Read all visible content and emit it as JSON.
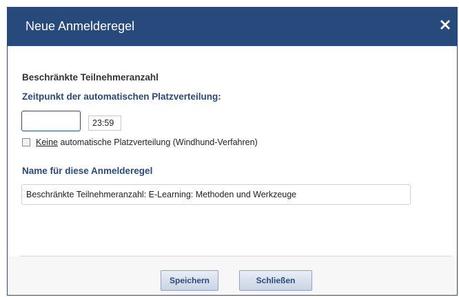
{
  "dialog": {
    "title": "Neue Anmelderegel",
    "close_icon": "close-icon"
  },
  "rule": {
    "type_label": "Beschränkte Teilnehmeranzahl",
    "distribution_heading": "Zeitpunkt der automatischen Platzverteilung:",
    "date_value": "",
    "time_value": "23:59",
    "no_auto_checkbox_underlined": "Keine",
    "no_auto_checkbox_rest": " automatische Platzverteilung (Windhund-Verfahren)",
    "no_auto_checked": false,
    "name_heading": "Name für diese Anmelderegel",
    "name_value": "Beschränkte Teilnehmeranzahl: E-Learning: Methoden und Werkzeuge"
  },
  "footer": {
    "save_label": "Speichern",
    "close_label": "Schließen"
  },
  "colors": {
    "accent": "#28497c"
  }
}
